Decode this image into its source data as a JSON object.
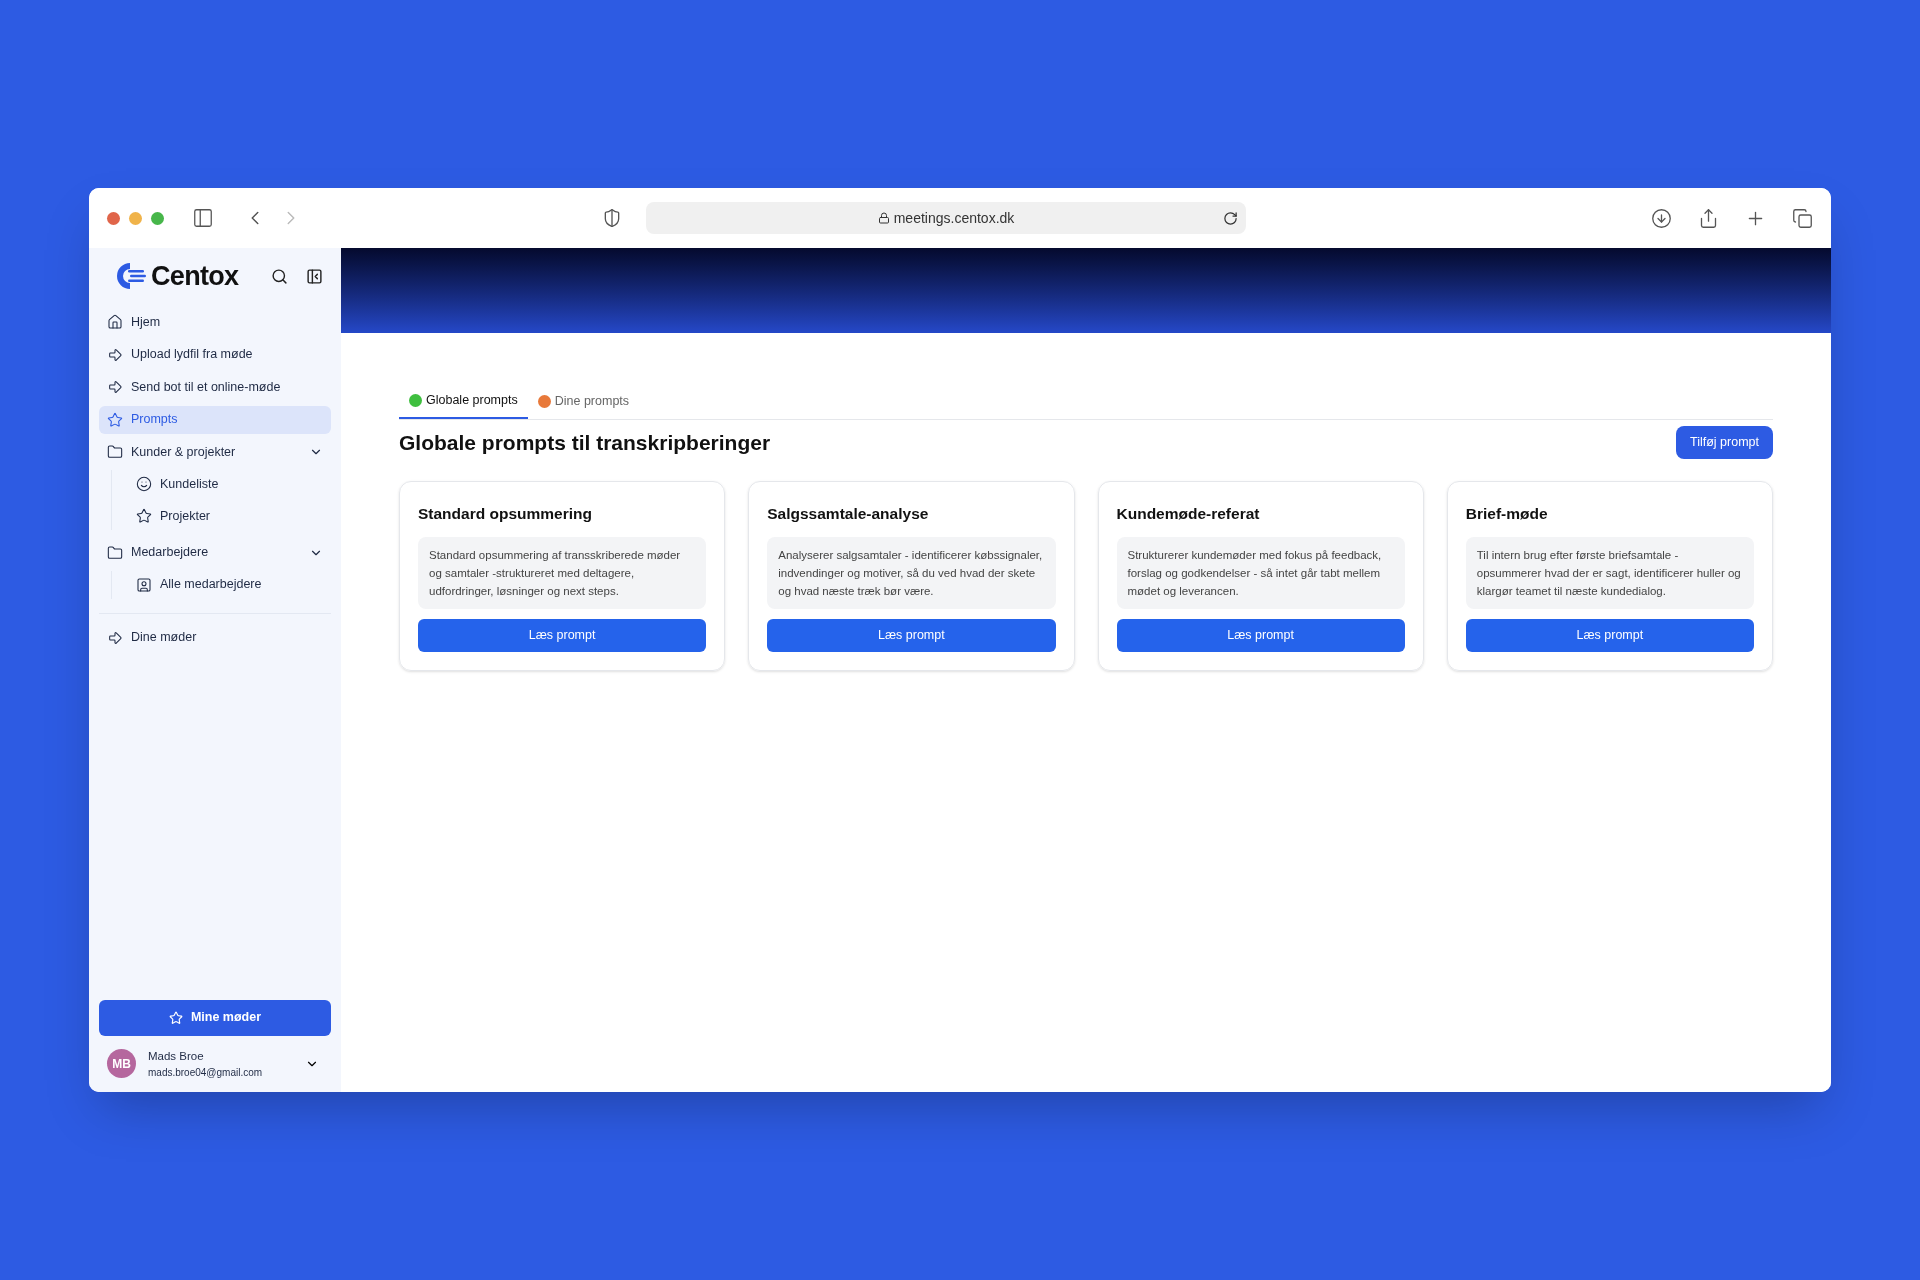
{
  "browser": {
    "url": "meetings.centox.dk"
  },
  "sidebar": {
    "brand": "Centox",
    "nav": [
      {
        "label": "Hjem",
        "kind": "home",
        "selected": false
      },
      {
        "label": "Upload lydfil fra møde",
        "kind": "arrow",
        "selected": false
      },
      {
        "label": "Send bot til et online-møde",
        "kind": "arrow",
        "selected": false
      },
      {
        "label": "Prompts",
        "kind": "star",
        "selected": true
      },
      {
        "label": "Kunder & projekter",
        "kind": "folder",
        "selected": false,
        "expanded": true,
        "children": [
          {
            "label": "Kundeliste",
            "kind": "smile",
            "selected": false
          },
          {
            "label": "Projekter",
            "kind": "star",
            "selected": false
          }
        ]
      },
      {
        "label": "Medarbejdere",
        "kind": "folder",
        "selected": false,
        "expanded": true,
        "children": [
          {
            "label": "Alle medarbejdere",
            "kind": "contact",
            "selected": false
          }
        ]
      }
    ],
    "nav_bottom": [
      {
        "label": "Dine møder",
        "kind": "arrow",
        "selected": false
      }
    ],
    "primary_button": "Mine møder",
    "user": {
      "initials": "MB",
      "name": "Mads Broe",
      "email": "mads.broe04@gmail.com"
    }
  },
  "tabs": [
    {
      "label": "Globale prompts",
      "color": "#3fbf3f",
      "selected": true
    },
    {
      "label": "Dine prompts",
      "color": "#e8793a",
      "selected": false
    }
  ],
  "heading": "Globale prompts til transkripberinger",
  "add_button": "Tilføj prompt",
  "cards": [
    {
      "title": "Standard opsummering",
      "description": "Standard opsummering af transskriberede møder og samtaler -struktureret med deltagere, udfordringer, løsninger og next steps.",
      "button": "Læs prompt"
    },
    {
      "title": "Salgssamtale-analyse",
      "description": "Analyserer salgsamtaler - identificerer købssignaler, indvendinger og motiver, så du ved hvad der skete og hvad næste træk bør være.",
      "button": "Læs prompt"
    },
    {
      "title": "Kundemøde-referat",
      "description": "Strukturerer kundemøder med fokus på feedback, forslag og godkendelser - så intet går tabt mellem mødet og leverancen.",
      "button": "Læs prompt"
    },
    {
      "title": "Brief-møde",
      "description": "Til intern brug efter første briefsamtale - opsummerer hvad der er sagt, identificerer huller og klargør teamet til næste kundedialog.",
      "button": "Læs prompt"
    }
  ]
}
